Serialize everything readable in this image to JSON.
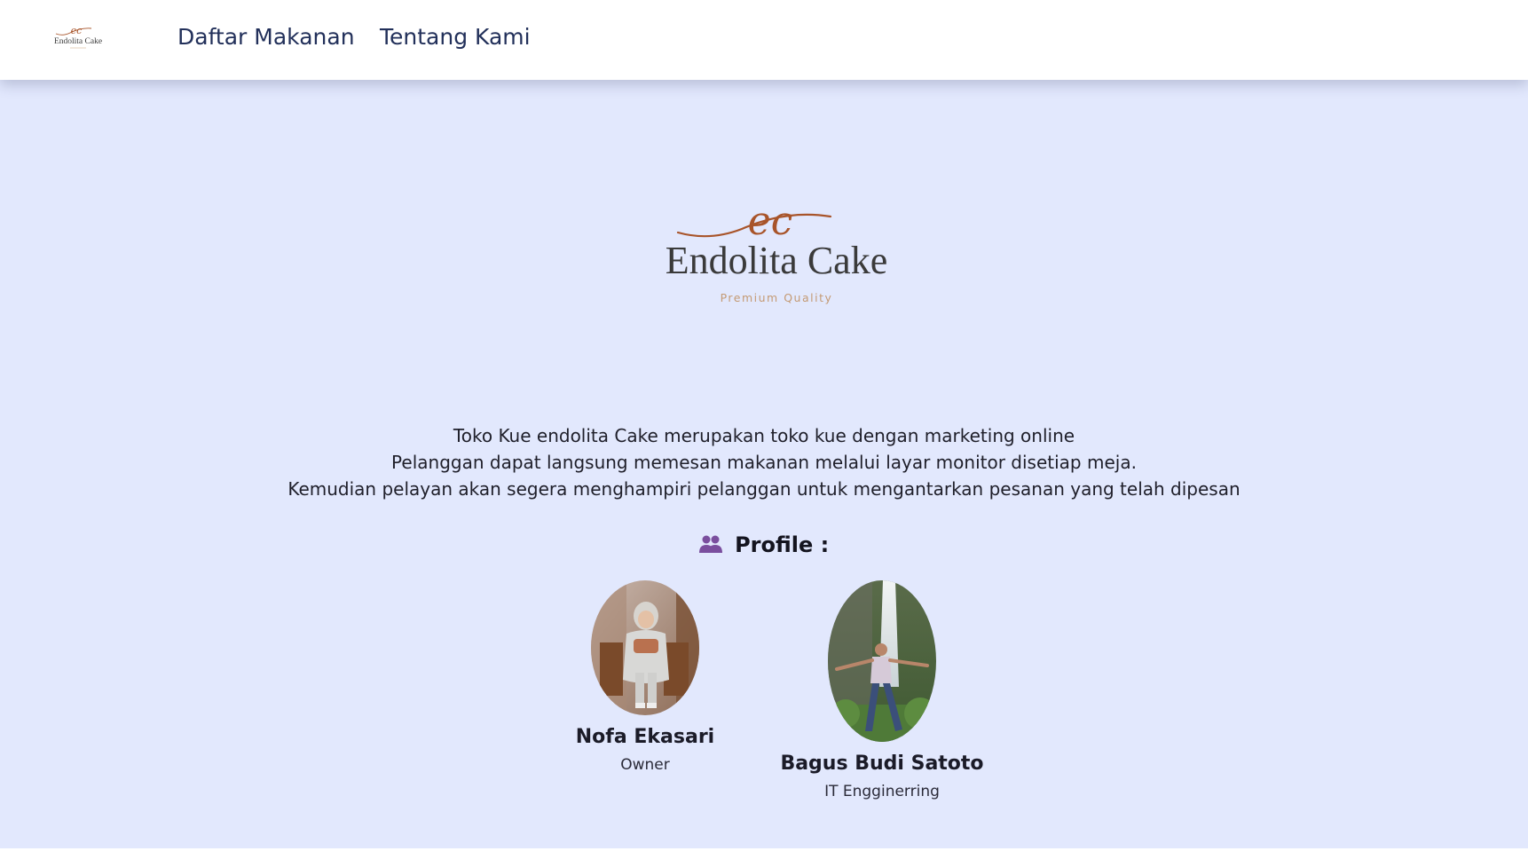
{
  "navbar": {
    "logo_text": "Endolita Cake",
    "links": [
      {
        "label": "Daftar Makanan"
      },
      {
        "label": "Tentang Kami"
      }
    ]
  },
  "hero": {
    "logo_monogram": "ec",
    "logo_title": "Endolita Cake",
    "logo_tagline": "Premium Quality"
  },
  "description": {
    "lines": [
      "Toko Kue endolita Cake merupakan toko kue dengan marketing online",
      "Pelanggan dapat langsung memesan makanan melalui layar monitor disetiap meja.",
      "Kemudian pelayan akan segera menghampiri pelanggan untuk mengantarkan pesanan yang telah dipesan"
    ]
  },
  "profile": {
    "heading": "Profile :",
    "heading_icon": "people-icon",
    "members": [
      {
        "name": "Nofa Ekasari",
        "role": "Owner"
      },
      {
        "name": "Bagus Budi Satoto",
        "role": "IT Engginerring"
      }
    ]
  },
  "colors": {
    "background": "#e2e8fd",
    "nav_link": "#22305a",
    "logo_accent": "#a8542a"
  }
}
